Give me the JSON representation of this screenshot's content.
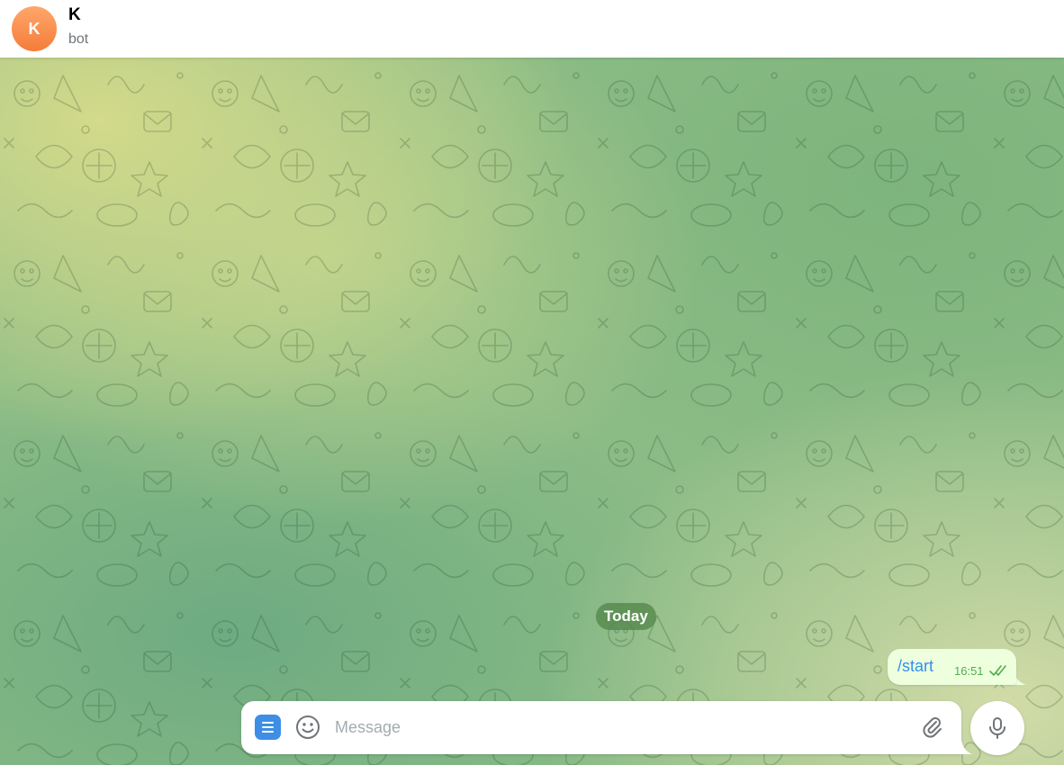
{
  "header": {
    "avatar_letter": "K",
    "title": "K",
    "subtitle": "bot"
  },
  "chat": {
    "date_separator": "Today",
    "messages": [
      {
        "text": "/start",
        "time": "16:51",
        "direction": "outgoing",
        "status": "read",
        "status_icon": "double-check-icon"
      }
    ]
  },
  "composer": {
    "placeholder": "Message",
    "value": "",
    "menu_icon": "menu-icon",
    "emoji_icon": "smile-icon",
    "attach_icon": "paperclip-icon",
    "mic_icon": "microphone-icon"
  },
  "colors": {
    "avatar_gradient": [
      "#ffa66a",
      "#f47d3a"
    ],
    "outgoing_bubble": "#eeffde",
    "command_link": "#3390ec",
    "read_check": "#4fae4e",
    "menu_button": "#3e8ee6",
    "date_pill": "#53874a",
    "chat_background": "#8cbc86"
  }
}
